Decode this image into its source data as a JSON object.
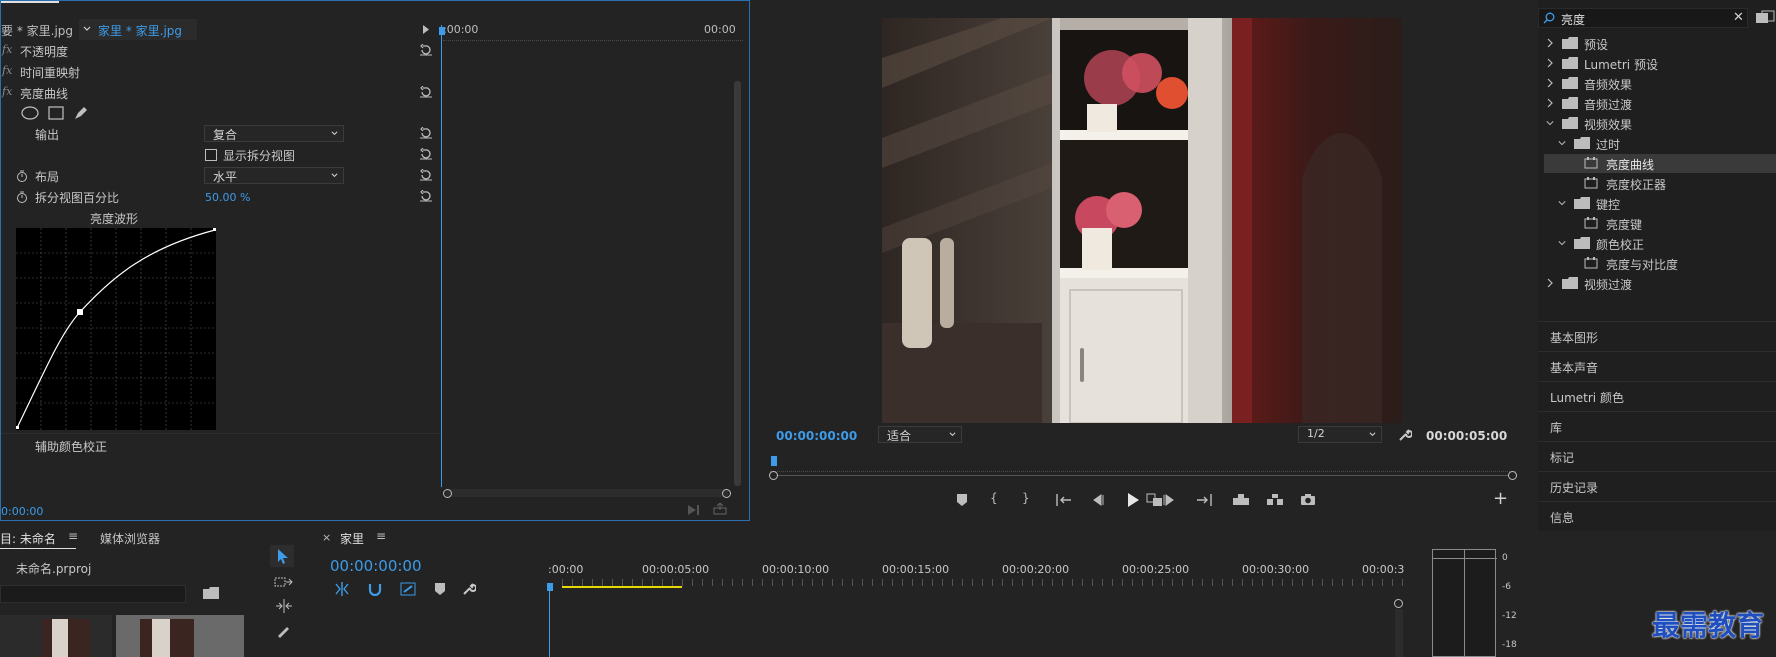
{
  "effect_controls": {
    "source_tab": "要 * 家里.jpg",
    "clip_tab": "家里 * 家里.jpg",
    "time_start": ":00:00",
    "time_end": "00:00",
    "current_time": "0:00:00",
    "rows": {
      "opacity": "不透明度",
      "time_remap": "时间重映射",
      "luma_curve": "亮度曲线",
      "output_label": "输出",
      "output_value": "复合",
      "show_split": "显示拆分视图",
      "layout_label": "布局",
      "layout_value": "水平",
      "split_pct_label": "拆分视图百分比",
      "split_pct_value": "50.00 %",
      "waveform_label": "亮度波形",
      "secondary": "辅助颜色校正"
    },
    "fx_glyph": "fx"
  },
  "program": {
    "timecode": "00:00:00:00",
    "fit": "适合",
    "resolution": "1/2",
    "duration": "00:00:05:00"
  },
  "effects": {
    "search_value": "亮度",
    "tree": [
      {
        "label": "预设",
        "expanded": false
      },
      {
        "label": "Lumetri 预设",
        "expanded": false
      },
      {
        "label": "音频效果",
        "expanded": false
      },
      {
        "label": "音频过渡",
        "expanded": false
      },
      {
        "label": "视频效果",
        "expanded": true
      },
      {
        "label": "过时",
        "expanded": true
      },
      {
        "label": "亮度曲线",
        "selected": true
      },
      {
        "label": "亮度校正器"
      },
      {
        "label": "键控",
        "expanded": true
      },
      {
        "label": "亮度键"
      },
      {
        "label": "颜色校正",
        "expanded": true
      },
      {
        "label": "亮度与对比度"
      },
      {
        "label": "视频过渡",
        "expanded": false
      }
    ],
    "stack": [
      "基本图形",
      "基本声音",
      "Lumetri 颜色",
      "库",
      "标记",
      "历史记录",
      "信息"
    ]
  },
  "project": {
    "tab": "目: 未命名",
    "tab2": "媒体浏览器",
    "file": "未命名.prproj"
  },
  "timeline": {
    "tab": "家里",
    "timecode": "00:00:00:00",
    "ruler": [
      ":00:00",
      "00:00:05:00",
      "00:00:10:00",
      "00:00:15:00",
      "00:00:20:00",
      "00:00:25:00",
      "00:00:30:00",
      "00:00:3"
    ]
  },
  "meter": {
    "ticks": [
      "0",
      "-6",
      "-12",
      "-18"
    ]
  },
  "watermark": "最需教育",
  "colors": {
    "accent": "#3d9be9",
    "selected": "#3a3a3a",
    "bg": "#232323"
  }
}
